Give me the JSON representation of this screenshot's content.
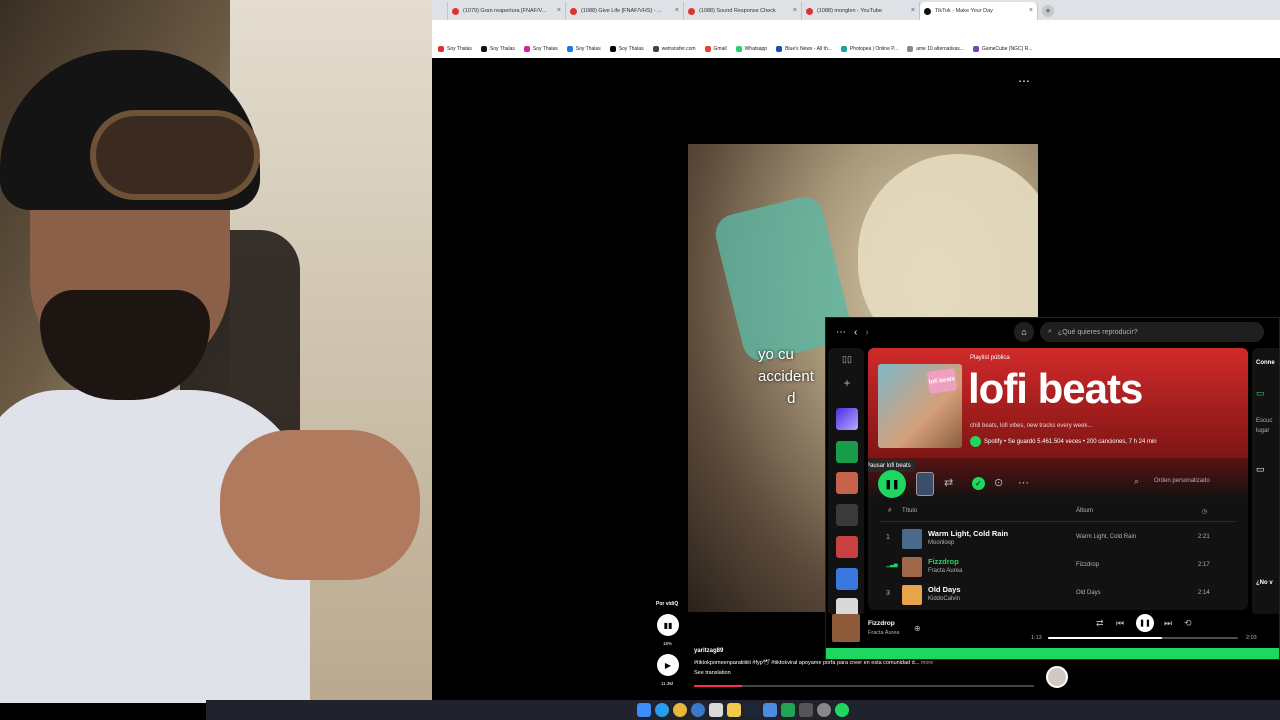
{
  "browser": {
    "tabs": [
      {
        "label": "(1079) Gran reapertura [FNAF/V..."
      },
      {
        "label": "(1088) Give Life [FNAF/VHS] - ..."
      },
      {
        "label": "(1088) Sound Response Check"
      },
      {
        "label": "(1088) monglen - YouTube"
      },
      {
        "label": "TikTok - Make Your Day",
        "active": true
      }
    ],
    "new_tab": "+",
    "close": "×",
    "bookmarks": [
      {
        "label": "Soy Thalas",
        "color": "#e0312d"
      },
      {
        "label": "Soy Thalas",
        "color": "#111111"
      },
      {
        "label": "Soy Thalas",
        "color": "#d6249f"
      },
      {
        "label": "Soy Thalas",
        "color": "#1877f2"
      },
      {
        "label": "Soy Thalas",
        "color": "#000000"
      },
      {
        "label": "wetransfer.com",
        "color": "#444444"
      },
      {
        "label": "Gmail",
        "color": "#ea4335"
      },
      {
        "label": "Whatsapp",
        "color": "#25d366"
      },
      {
        "label": "Blue's News - All th...",
        "color": "#1a4fb0"
      },
      {
        "label": "Photopea | Online P...",
        "color": "#18a497"
      },
      {
        "label": "ame 10 alternativas...",
        "color": "#888888"
      },
      {
        "label": "GameCube (NGC) R...",
        "color": "#7a3fb0"
      }
    ]
  },
  "tiktok": {
    "more": "⋯",
    "caption": "yo cu\naccident\n       d",
    "author_label": "Por vidiQ",
    "stat1": "18%",
    "stat2": "11.3M",
    "username": "yaritzag89",
    "description": "#tiktokpomeenparatiiiiiii #fyp🕊 #tiktokviral apoyame porfa para creer en esta comunidad d...",
    "more_label": "more",
    "see_translation": "See translation",
    "progress": 0.14
  },
  "spotify": {
    "search_placeholder": "¿Qué quieres reproducir?",
    "playlist_type": "Playlist pública",
    "title": "lofi beats",
    "cover_label": "lofi beats",
    "description": "chill beats, lofi vibes, new tracks every week...",
    "meta": "Spotify • Se guardó 5.461.504 veces • 200 canciones, 7 h 24 min",
    "tooltip": "Pausar lofi beats",
    "order": "Orden personalizado",
    "col_num": "#",
    "col_title": "Título",
    "col_album": "Álbum",
    "tracks": [
      {
        "num": "1",
        "title": "Warm Light, Cold Rain",
        "artist": "Moonloop",
        "album": "Warm Light, Cold Rain",
        "duration": "2:21",
        "art": "#4a6a8a"
      },
      {
        "num": "",
        "title": "Fizzdrop",
        "artist": "Fracta Aurea",
        "album": "Fizzdrop",
        "duration": "2:17",
        "art": "#a0674a",
        "playing": true
      },
      {
        "num": "3",
        "title": "Old Days",
        "artist": "KiddoCalvin",
        "album": "Old Days",
        "duration": "2:14",
        "art": "#e8a44a"
      }
    ],
    "right_panel": {
      "title": "Conne",
      "line1": "Escuc",
      "line2": "lugar",
      "bottom": "¿No v"
    },
    "now_playing": {
      "title": "Fizzdrop",
      "artist": "Fracta Aurea",
      "elapsed": "1:13",
      "total": "2:03",
      "progress": 0.6
    },
    "colors": {
      "accent": "#1ed760",
      "header": "#d12a2a"
    }
  }
}
